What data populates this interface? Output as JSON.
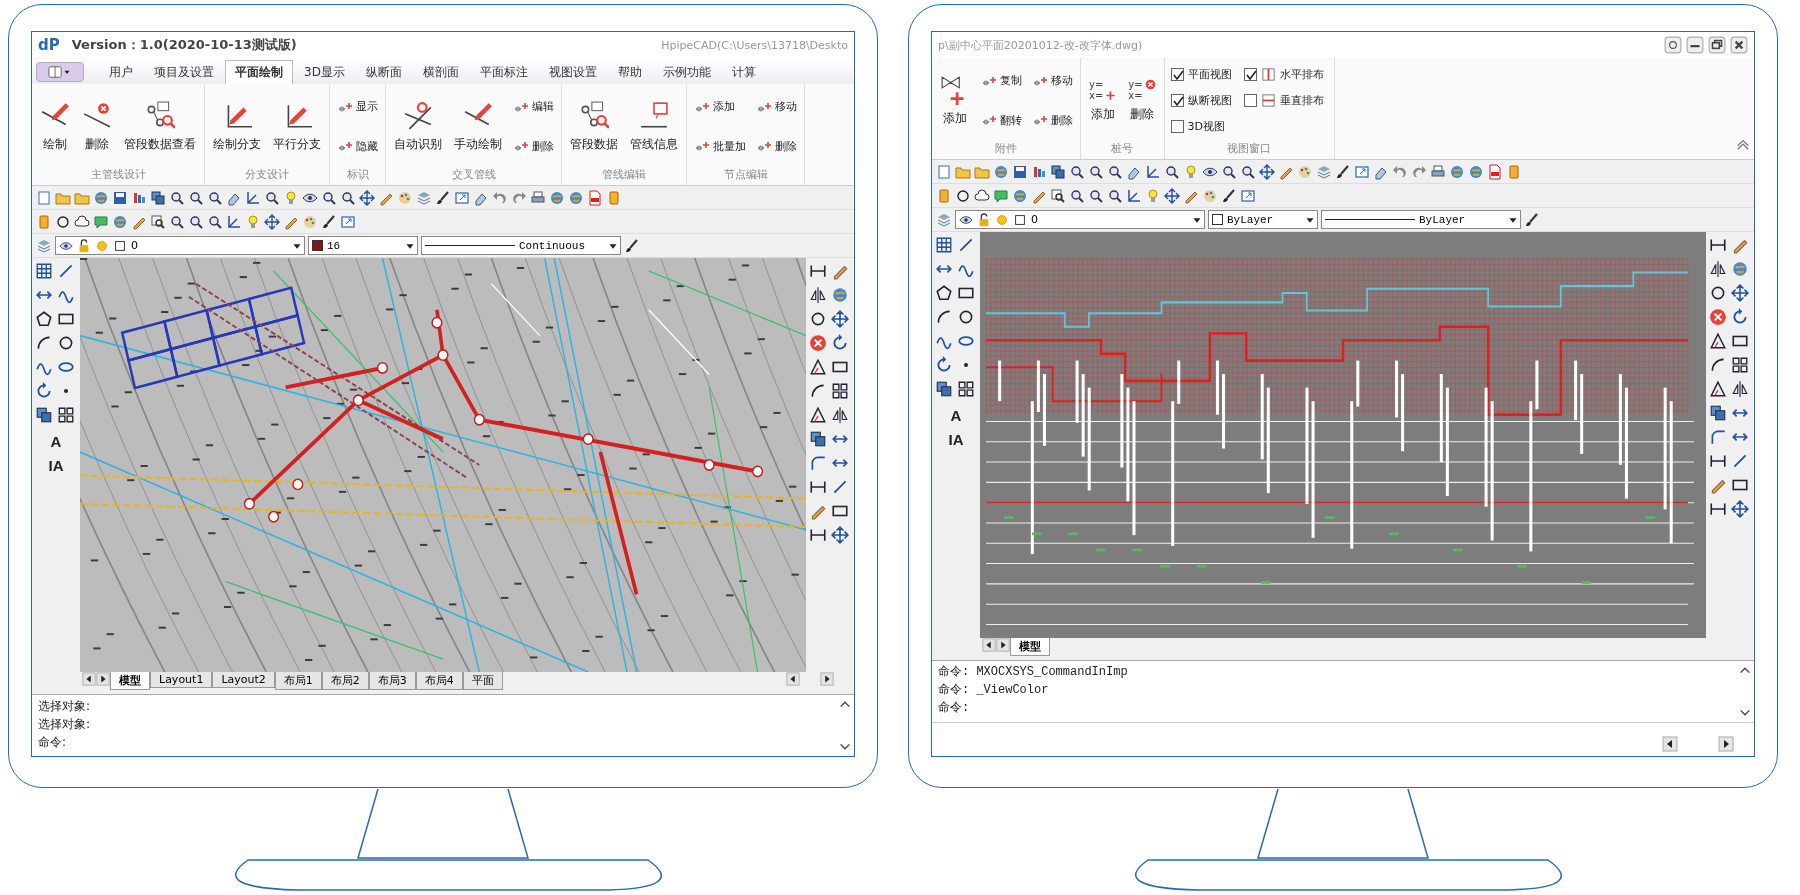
{
  "monitors": [
    {
      "kind": "plan",
      "title": {
        "logo": "dP",
        "version": "Version：1.0(2020-10-13测试版)",
        "path": "HpipeCAD(C:\\Users\\13718\\Deskto"
      },
      "tabs": [
        {
          "label": "用户",
          "selected": false
        },
        {
          "label": "项目及设置",
          "selected": false
        },
        {
          "label": "平面绘制",
          "selected": true
        },
        {
          "label": "3D显示",
          "selected": false
        },
        {
          "label": "纵断面",
          "selected": false
        },
        {
          "label": "横剖面",
          "selected": false
        },
        {
          "label": "平面标注",
          "selected": false
        },
        {
          "label": "视图设置",
          "selected": false
        },
        {
          "label": "帮助",
          "selected": false
        },
        {
          "label": "示例功能",
          "selected": false
        },
        {
          "label": "计算",
          "selected": false
        }
      ],
      "ribbon": [
        {
          "label": "主管线设计",
          "items": [
            {
              "kind": "large",
              "label": "绘制"
            },
            {
              "kind": "large",
              "label": "删除"
            },
            {
              "kind": "large",
              "label": "管段数据查看"
            }
          ]
        },
        {
          "label": "分支设计",
          "items": [
            {
              "kind": "large",
              "label": "绘制分支"
            },
            {
              "kind": "large",
              "label": "平行分支"
            }
          ]
        },
        {
          "label": "标识",
          "items": [
            {
              "kind": "small",
              "label": "显示"
            },
            {
              "kind": "small",
              "label": "隐藏"
            }
          ]
        },
        {
          "label": "交叉管线",
          "items": [
            {
              "kind": "large",
              "label": "自动识别"
            },
            {
              "kind": "large",
              "label": "手动绘制"
            },
            {
              "kind": "small",
              "label": "编辑"
            },
            {
              "kind": "small",
              "label": "删除"
            }
          ]
        },
        {
          "label": "管线编辑",
          "items": [
            {
              "kind": "large",
              "label": "管段数据"
            },
            {
              "kind": "large",
              "label": "管线信息"
            }
          ]
        },
        {
          "label": "节点编辑",
          "items": [
            {
              "kind": "small",
              "label": "添加"
            },
            {
              "kind": "small",
              "label": "批量加"
            },
            {
              "kind": "small",
              "label": "移动"
            },
            {
              "kind": "small",
              "label": "删除"
            }
          ]
        }
      ],
      "properties": {
        "layer": "0",
        "color_name": "16",
        "linetype": "Continuous"
      },
      "text_tools": [
        "A",
        "IA"
      ],
      "layouts": [
        {
          "label": "模型",
          "selected": true
        },
        {
          "label": "Layout1",
          "selected": false
        },
        {
          "label": "Layout2",
          "selected": false
        },
        {
          "label": "布局1",
          "selected": false
        },
        {
          "label": "布局2",
          "selected": false
        },
        {
          "label": "布局3",
          "selected": false
        },
        {
          "label": "布局4",
          "selected": false
        },
        {
          "label": "平面",
          "selected": false
        }
      ],
      "commands": [
        "选择对象:",
        "选择对象:",
        "命令:"
      ]
    },
    {
      "kind": "profile",
      "title": {
        "path": "p\\副中心平面20201012-改-改字体.dwg)"
      },
      "ribbon": [
        {
          "label": "附件",
          "items": [
            {
              "kind": "large",
              "label": "添加"
            },
            {
              "kind": "small",
              "label": "复制"
            },
            {
              "kind": "small",
              "label": "翻转"
            },
            {
              "kind": "small",
              "label": "移动"
            },
            {
              "kind": "small",
              "label": "删除"
            }
          ]
        },
        {
          "label": "桩号",
          "items": [
            {
              "kind": "formula",
              "formula": [
                "y=",
                "x="
              ],
              "label": "添加"
            },
            {
              "kind": "formula",
              "formula": [
                "y=",
                "x="
              ],
              "label": "删除"
            }
          ]
        },
        {
          "label": "视图窗口",
          "items": [
            {
              "kind": "check",
              "label": "平面视图",
              "checked": true
            },
            {
              "kind": "check",
              "label": "纵断视图",
              "checked": true
            },
            {
              "kind": "check",
              "label": "3D视图",
              "checked": false
            },
            {
              "kind": "arrange",
              "label": "水平排布",
              "checked": true
            },
            {
              "kind": "arrange",
              "label": "垂直排布",
              "checked": false
            }
          ]
        }
      ],
      "properties": {
        "layer": "0",
        "color_name": "ByLayer",
        "linetype": "ByLayer"
      },
      "text_tools": [
        "A",
        "IA"
      ],
      "layouts": [
        {
          "label": "模型",
          "selected": true
        }
      ],
      "commands": [
        "命令: MXOCXSYS_CommandInImp",
        "命令: _ViewColor",
        "命令:"
      ]
    }
  ]
}
